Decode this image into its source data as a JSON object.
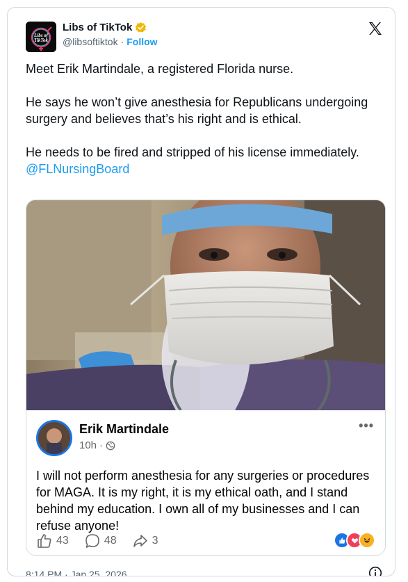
{
  "author": {
    "name": "Libs of TikTok",
    "handle": "@libsoftiktok",
    "separator": "·",
    "follow_label": "Follow",
    "avatar_text_line1": "Libs of",
    "avatar_text_line2": "TikTok",
    "verified_color": "#f2b705",
    "avatar_accent": "#e8336c"
  },
  "tweet": {
    "paragraph_1": "Meet Erik Martindale, a registered Florida nurse.",
    "paragraph_2": "He says he won’t give anesthesia for Republicans undergoing surgery and believes that’s his right and is ethical.",
    "paragraph_3_text": "He needs to be fired and stripped of his license immediately.",
    "paragraph_3_mention": "@FLNursingBoard",
    "timestamp": "8:14 PM · Jan 25, 2026"
  },
  "fb_post": {
    "name": "Erik Martindale",
    "time": "10h",
    "dot": "·",
    "more_label": "•••",
    "text": "I will not perform anesthesia for any surgeries or procedures for MAGA. It is my right, it is my ethical oath, and I stand behind my education. I own all of my businesses and I can refuse anyone!",
    "likes": "43",
    "comments": "48",
    "shares": "3",
    "reactions": [
      "like-icon",
      "love-icon",
      "haha-icon"
    ]
  },
  "colors": {
    "link": "#1d9bf0",
    "text": "#0f1419",
    "muted": "#536471",
    "fb_blue": "#1b74e4"
  }
}
